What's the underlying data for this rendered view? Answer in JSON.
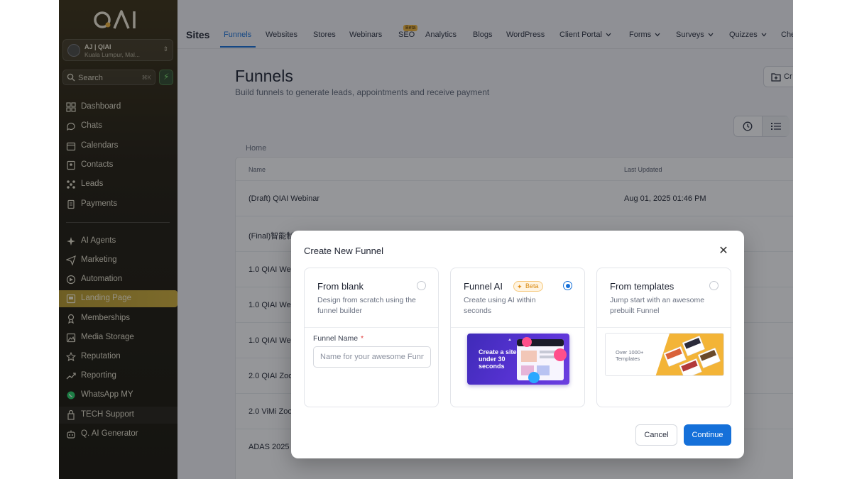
{
  "sidebar": {
    "logo_text": "QAI",
    "account": {
      "name": "AJ | QIAI",
      "location": "Kuala Lumpur, Mal..."
    },
    "search": {
      "label": "Search",
      "shortcut": "⌘K"
    },
    "items": [
      {
        "label": "Dashboard",
        "icon": "dashboard-icon"
      },
      {
        "label": "Chats",
        "icon": "chat-icon"
      },
      {
        "label": "Calendars",
        "icon": "calendar-icon"
      },
      {
        "label": "Contacts",
        "icon": "contacts-icon"
      },
      {
        "label": "Leads",
        "icon": "leads-icon"
      },
      {
        "label": "Payments",
        "icon": "payments-icon"
      },
      {
        "label": "AI Agents",
        "icon": "sparkle-icon"
      },
      {
        "label": "Marketing",
        "icon": "send-icon"
      },
      {
        "label": "Automation",
        "icon": "automation-icon"
      },
      {
        "label": "Landing Page",
        "icon": "landing-page-icon"
      },
      {
        "label": "Memberships",
        "icon": "memberships-icon"
      },
      {
        "label": "Media Storage",
        "icon": "media-icon"
      },
      {
        "label": "Reputation",
        "icon": "star-icon"
      },
      {
        "label": "Reporting",
        "icon": "trend-icon"
      },
      {
        "label": "WhatsApp MY",
        "icon": "whatsapp-icon"
      },
      {
        "label": "TECH Support",
        "icon": "support-icon"
      },
      {
        "label": "Q. AI Generator",
        "icon": "robot-icon"
      }
    ]
  },
  "topnav": {
    "section": "Sites",
    "tabs": [
      "Funnels",
      "Websites",
      "Stores",
      "Webinars",
      "SEO",
      "Analytics",
      "Blogs",
      "WordPress",
      "Client Portal",
      "Forms",
      "Surveys",
      "Quizzes",
      "Che"
    ],
    "seo_badge": "Beta"
  },
  "main": {
    "title": "Funnels",
    "subtitle": "Build funnels to generate leads, appointments and receive payment",
    "create_label": "Cr",
    "breadcrumb": "Home",
    "columns": [
      "Name",
      "Last Updated"
    ],
    "rows": [
      {
        "name": "(Draft) QIAI Webinar",
        "updated": "Aug 01, 2025 01:46 PM"
      },
      {
        "name": "(Final)智能制",
        "updated": ""
      },
      {
        "name": "1.0 QIAI We",
        "updated": ""
      },
      {
        "name": "1.0 QIAI We",
        "updated": ""
      },
      {
        "name": "1.0 QIAI We",
        "updated": ""
      },
      {
        "name": "2.0 QIAI Zoo",
        "updated": ""
      },
      {
        "name": "2.0 ViMi Zoo",
        "updated": ""
      },
      {
        "name": "ADAS 2025",
        "updated": ""
      }
    ]
  },
  "modal": {
    "title": "Create New Funnel",
    "options": [
      {
        "title": "From blank",
        "desc": "Design from scratch using the funnel builder",
        "selected": false
      },
      {
        "title": "Funnel AI",
        "badge": "Beta",
        "desc": "Create using AI within seconds",
        "selected": true,
        "thumb_text": "Create a site under 30 seconds"
      },
      {
        "title": "From templates",
        "desc": "Jump start with an awesome prebuilt Funnel",
        "selected": false,
        "thumb_text": "Over 1000+ Templates"
      }
    ],
    "field_label": "Funnel Name",
    "field_required": "*",
    "field_placeholder": "Name for your awesome Funnel",
    "field_value": "",
    "cancel_label": "Cancel",
    "continue_label": "Continue"
  },
  "colors": {
    "accent": "#1570d9",
    "sidebar_active": "#c9a832",
    "beta_badge": "#f4b63a"
  }
}
